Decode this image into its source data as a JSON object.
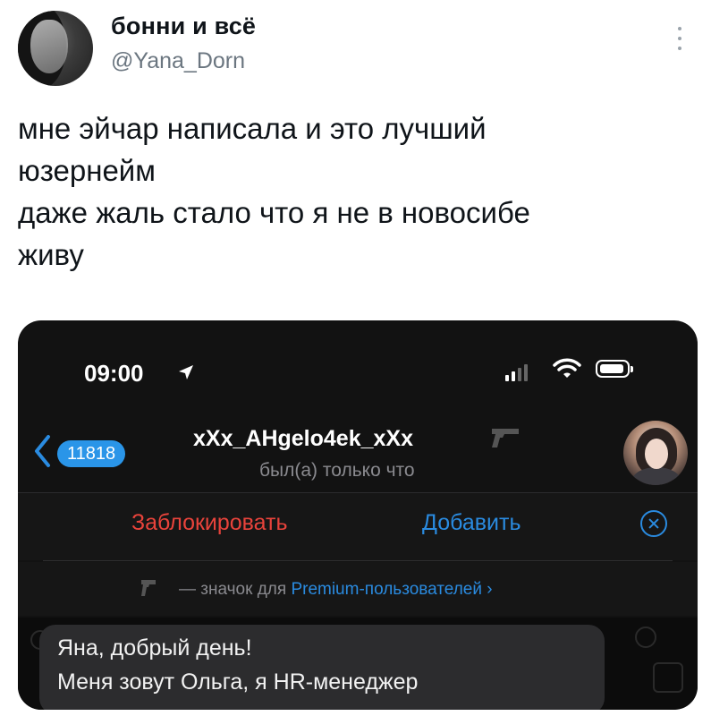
{
  "tweet": {
    "author_name": "бонни и всё",
    "author_handle": "@Yana_Dorn",
    "lines": [
      "мне эйчар написала и это лучший",
      "юзернейм",
      "даже жаль стало что я не в новосибе",
      "живу"
    ],
    "more_icon": "vertical-dots-icon"
  },
  "phone": {
    "status_bar": {
      "time": "09:00",
      "location_icon": "location-arrow-icon",
      "signal_icon": "cellular-signal-icon",
      "wifi_icon": "wifi-icon",
      "battery_icon": "battery-icon"
    },
    "chat_header": {
      "back_icon": "chevron-left-icon",
      "unread_count": "11818",
      "title": "xXx_AHgelo4ek_xXx",
      "premium_icon": "pistol-icon",
      "status": "был(а) только что"
    },
    "action_bar": {
      "block_label": "Заблокировать",
      "add_label": "Добавить",
      "close_icon": "close-circle-icon"
    },
    "premium_note": {
      "prefix": "— значок для ",
      "link": "Premium-пользователей",
      "chevron": "›"
    },
    "message": {
      "line1": "Яна, добрый день!",
      "line2": "Меня зовут Ольга, я HR-менеджер"
    },
    "colors": {
      "background": "#121212",
      "accent_blue": "#2a8be0",
      "danger_red": "#e8433b",
      "bubble": "#2c2c2e"
    }
  }
}
